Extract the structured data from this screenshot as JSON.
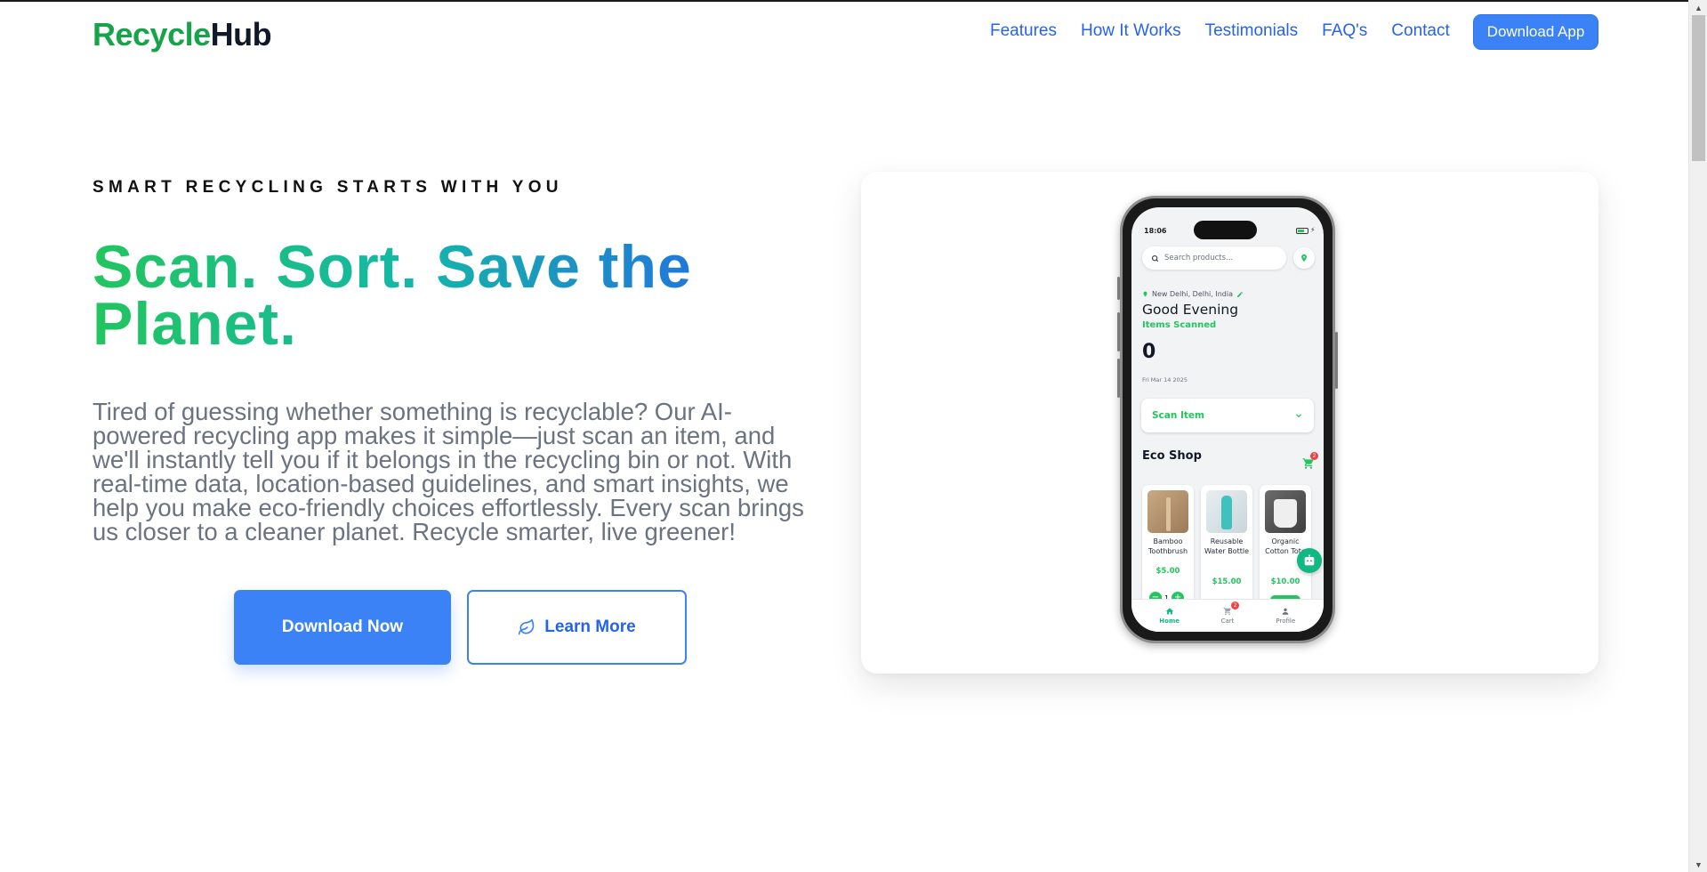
{
  "brand": {
    "part1": "Recycle",
    "part2": "Hub"
  },
  "nav": {
    "items": [
      {
        "label": "Features"
      },
      {
        "label": "How It Works"
      },
      {
        "label": "Testimonials"
      },
      {
        "label": "FAQ's"
      },
      {
        "label": "Contact"
      }
    ],
    "cta_label": "Download App"
  },
  "hero": {
    "tagline": "SMART RECYCLING STARTS WITH YOU",
    "headline": "Scan. Sort. Save the Planet.",
    "description": "Tired of guessing whether something is recyclable? Our AI-powered recycling app makes it simple—just scan an item, and we'll instantly tell you if it belongs in the recycling bin or not. With real-time data, location-based guidelines, and smart insights, we help you make eco-friendly choices effortlessly. Every scan brings us closer to a cleaner planet. Recycle smarter, live greener!",
    "primary_button": "Download Now",
    "secondary_button": "Learn More"
  },
  "colors": {
    "brand_green": "#16a34a",
    "accent_blue": "#3b82f6",
    "link_blue": "#2563eb",
    "app_green": "#22c55e",
    "badge_red": "#ef4444"
  },
  "phone": {
    "status_time": "18:06",
    "search_placeholder": "Search products...",
    "location": "New Delhi, Delhi, India",
    "greeting": "Good Evening",
    "items_scanned_label": "Items Scanned",
    "items_scanned_count": "0",
    "date": "Fri Mar 14 2025",
    "scan_item_label": "Scan Item",
    "eco_shop_title": "Eco Shop",
    "cart_count": "2",
    "products": [
      {
        "name": "Bamboo Toothbrush",
        "price": "$5.00",
        "qty": "1"
      },
      {
        "name": "Reusable Water Bottle",
        "price": "$15.00"
      },
      {
        "name": "Organic Cotton Tote",
        "price": "$10.00"
      }
    ],
    "tabs": [
      {
        "label": "Home"
      },
      {
        "label": "Cart",
        "badge": "2"
      },
      {
        "label": "Profile"
      }
    ],
    "icons": [
      "search-icon",
      "location-pin-icon",
      "pencil-icon",
      "chevron-down-icon",
      "cart-icon",
      "chat-bot-icon",
      "home-icon",
      "profile-icon",
      "leaf-icon"
    ]
  }
}
